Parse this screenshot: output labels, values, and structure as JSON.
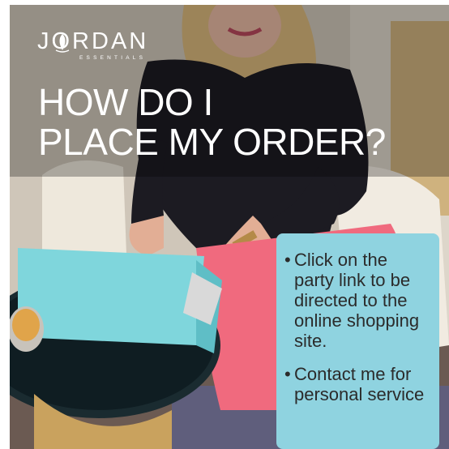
{
  "brand": {
    "logo_text": "JORDAN",
    "logo_subtext": "ESSENTIALS",
    "logo_icon": "leaf-icon"
  },
  "headline": {
    "line1": "HOW DO I",
    "line2": "PLACE MY ORDER?"
  },
  "info_card": {
    "bullets": [
      {
        "symbol": "•",
        "text": "Click on the party link to be directed to the online shopping site."
      },
      {
        "symbol": "•",
        "text": "Contact me for personal service"
      }
    ]
  },
  "colors": {
    "card": "#8fd3e0",
    "laptop": "#7fd6dc",
    "pants": "#f06a7e",
    "top": "#1c1b22"
  }
}
